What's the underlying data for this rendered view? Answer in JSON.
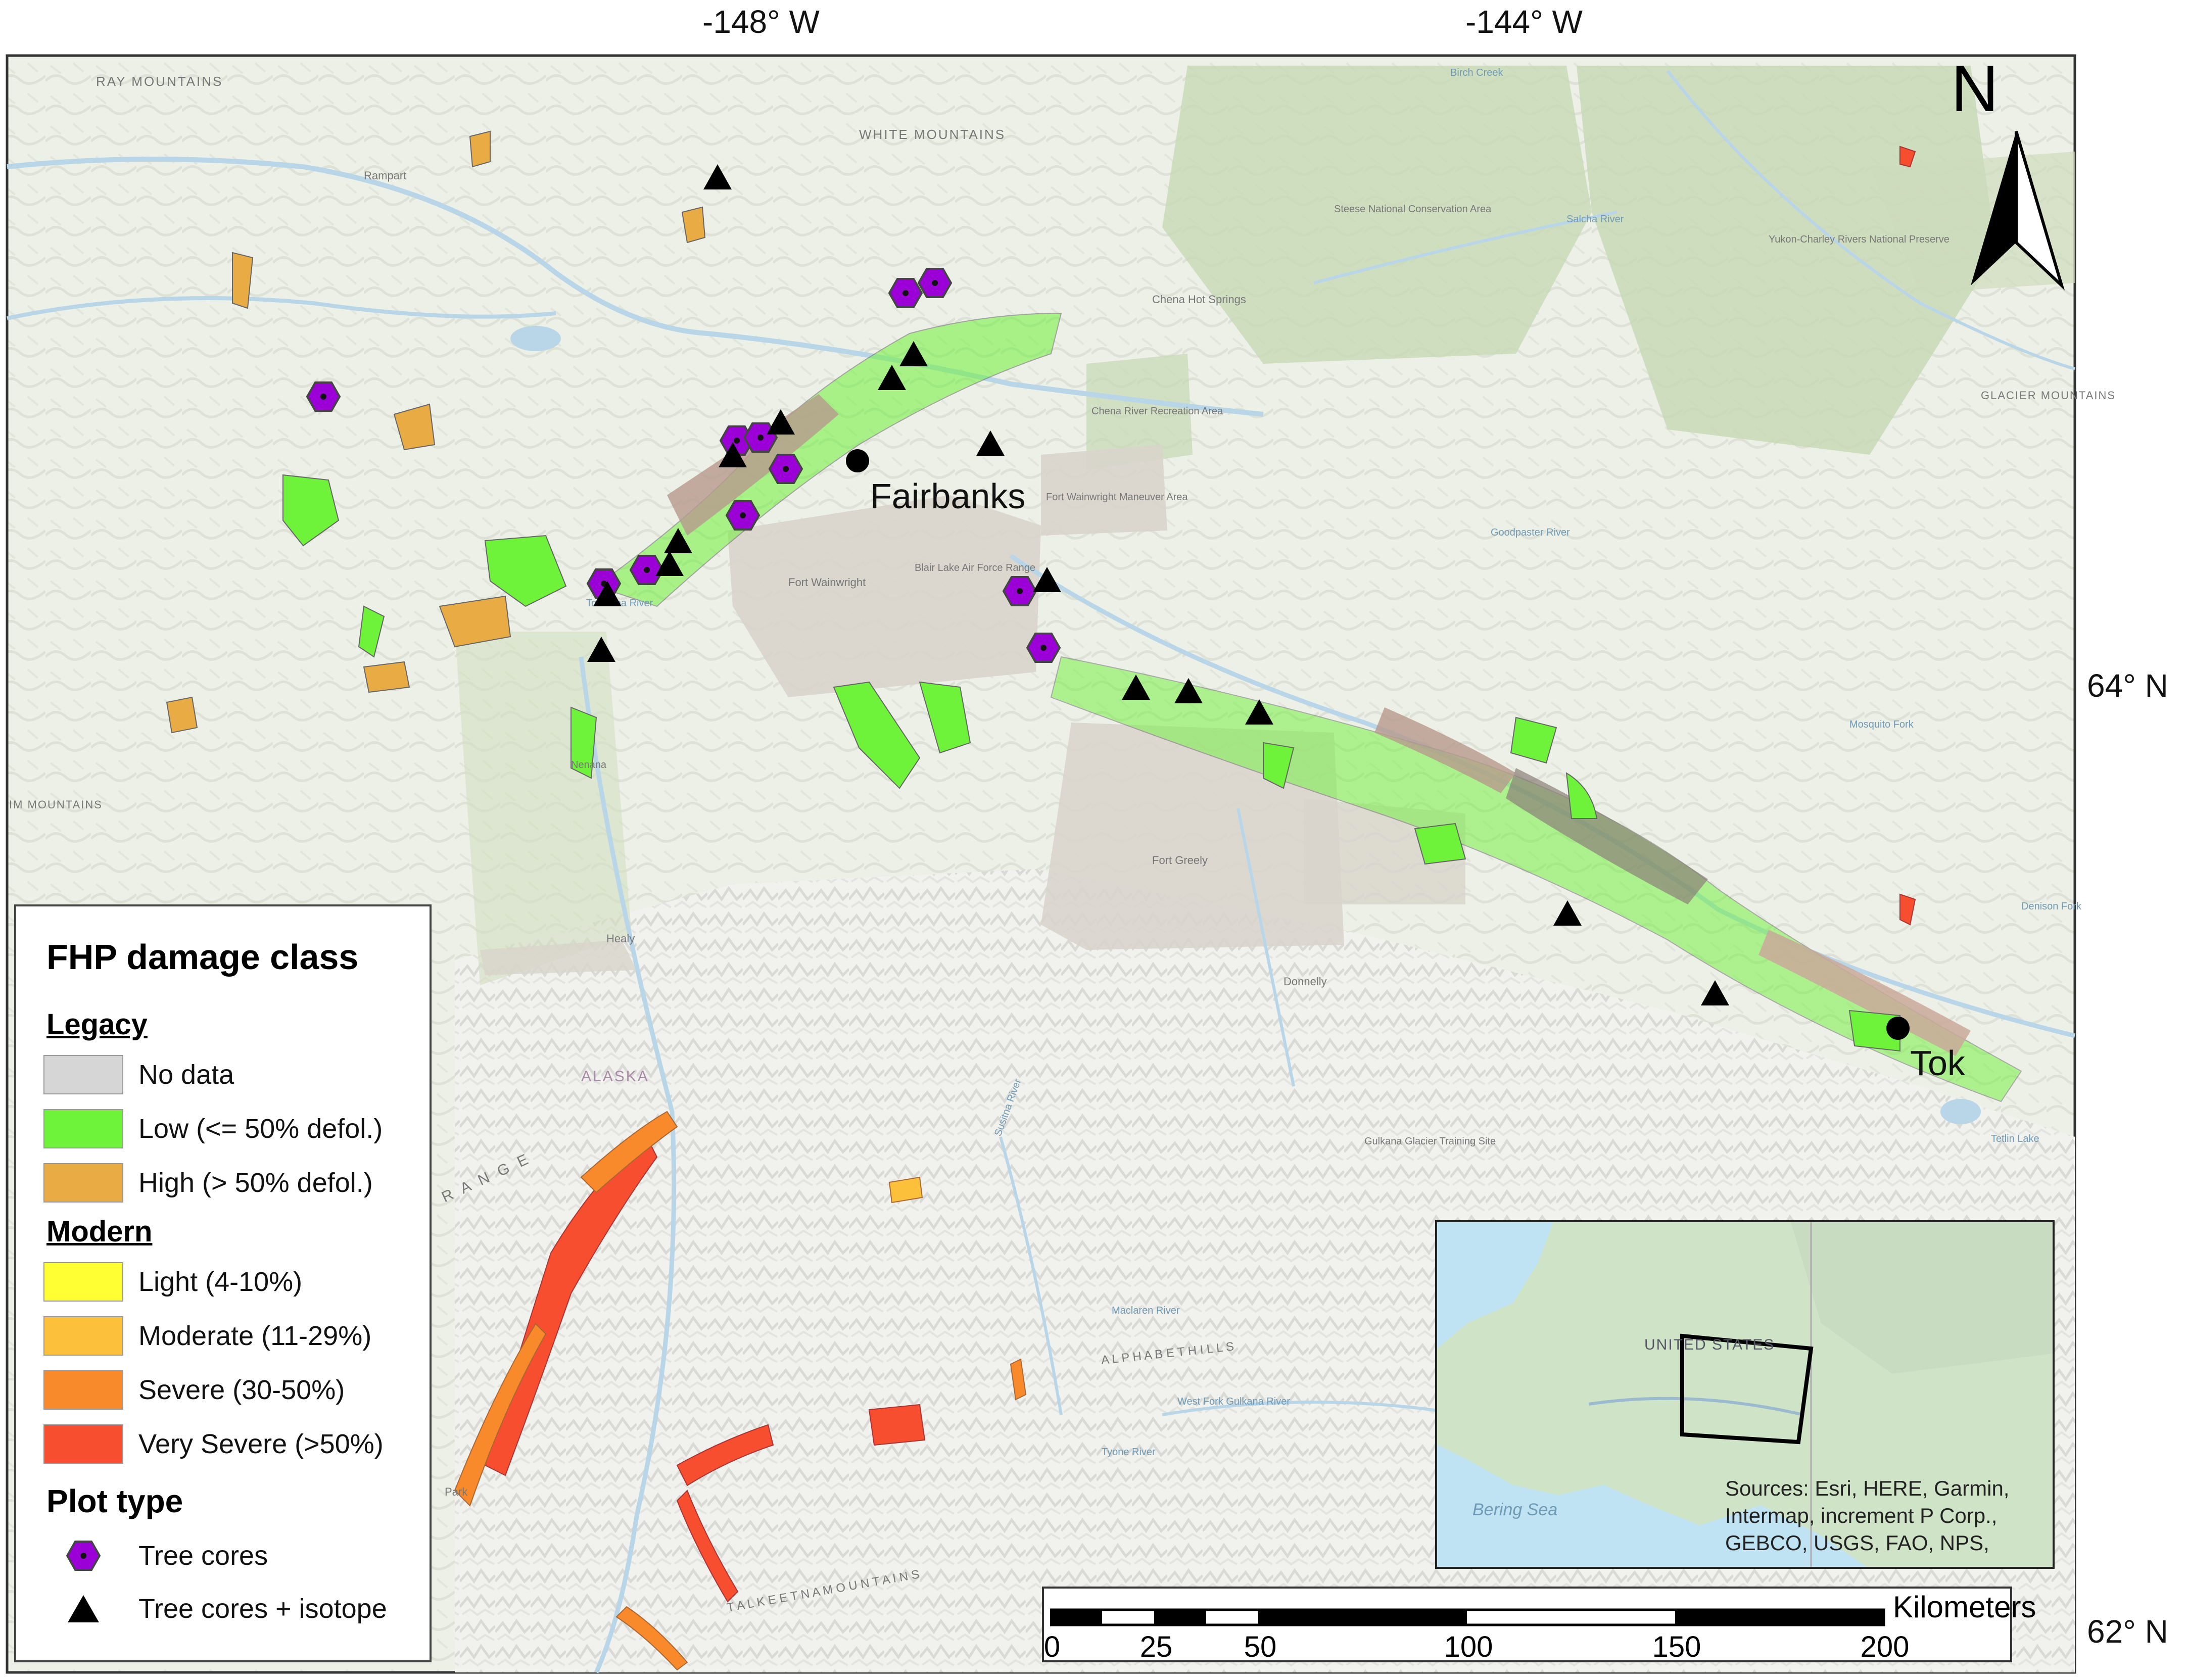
{
  "graticule": {
    "lon_left": "-148° W",
    "lon_right": "-144° W",
    "lat_top": "64° N",
    "lat_bottom": "62° N"
  },
  "north_arrow": {
    "label": "N"
  },
  "places": {
    "fairbanks": "Fairbanks",
    "tok": "Tok"
  },
  "basemap_labels": {
    "ray_mountains": "RAY MOUNTAINS",
    "white_mountains": "WHITE MOUNTAINS",
    "rampart": "Rampart",
    "steese": "Steese National Conservation Area",
    "yukon_charley": "Yukon-Charley Rivers National Preserve",
    "chena_hot_springs": "Chena Hot Springs",
    "chena_river": "Chena River Recreation Area",
    "fort_wainwright": "Fort Wainwright",
    "blair_lake": "Blair Lake Air Force Range",
    "fort_wainwright_maneuver": "Fort Wainwright Maneuver Area",
    "glacier_mountains": "GLACIER MOUNTAINS",
    "fort_greely": "Fort Greely",
    "healy": "Healy",
    "donnelly": "Donnelly",
    "alaska": "ALASKA",
    "alaska_range": "R A N G E",
    "kim_mountains": "IM MOUNTAINS",
    "gulkana": "Gulkana Glacier Training Site",
    "alphabet_hills": "A L P H A B E T   H I L L S",
    "talkeetna": "T A L K E E T N A   M O U N T A I N S",
    "maclaren": "Maclaren River",
    "west_fork": "West Fork Gulkana River",
    "tyone": "Tyone River",
    "susitna": "Susitna River",
    "tetlin": "Tetlin Lake",
    "mosquito_fork": "Mosquito Fork",
    "denison": "Denison Fork",
    "salcha": "Salcha River",
    "goodpaster": "Goodpaster River",
    "birch_creek": "Birch Creek",
    "tolovana": "Tolovana River",
    "nenana": "Nenana",
    "park": "Park"
  },
  "legend": {
    "title": "FHP damage class",
    "legacy_header": "Legacy",
    "legacy": [
      {
        "label": "No data",
        "color": "#d6d6d6"
      },
      {
        "label": "Low (<= 50% defol.)",
        "color": "#6ef23a"
      },
      {
        "label": "High (> 50% defol.)",
        "color": "#e9ac44"
      }
    ],
    "modern_header": "Modern",
    "modern": [
      {
        "label": "Light (4-10%)",
        "color": "#ffff33"
      },
      {
        "label": "Moderate (11-29%)",
        "color": "#fcc03a"
      },
      {
        "label": "Severe (30-50%)",
        "color": "#f88a2c"
      },
      {
        "label": "Very Severe (>50%)",
        "color": "#f64e2f"
      }
    ],
    "plot_header": "Plot type",
    "plots": [
      {
        "label": "Tree cores",
        "icon": "purple-hexagon-icon",
        "color": "#9b00d6"
      },
      {
        "label": "Tree cores + isotope",
        "icon": "black-triangle-icon",
        "color": "#000000"
      }
    ]
  },
  "inset": {
    "country_label": "UNITED STATES",
    "sources": "Sources: Esri, HERE, Garmin, Intermap, increment P Corp., GEBCO, USGS, FAO, NPS,",
    "sea_label": "Bering Sea"
  },
  "scale_bar": {
    "unit": "Kilometers",
    "ticks": [
      "0",
      "25",
      "50",
      "100",
      "150",
      "200"
    ]
  }
}
